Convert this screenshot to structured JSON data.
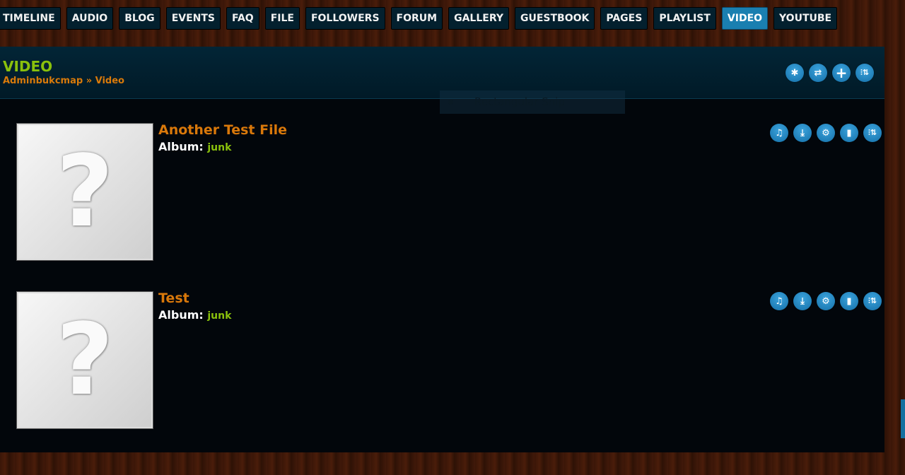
{
  "nav": {
    "tabs": [
      "TIMELINE",
      "AUDIO",
      "BLOG",
      "EVENTS",
      "FAQ",
      "FILE",
      "FOLLOWERS",
      "FORUM",
      "GALLERY",
      "GUESTBOOK",
      "PAGES",
      "PLAYLIST",
      "VIDEO",
      "YOUTUBE"
    ],
    "active": "VIDEO"
  },
  "header": {
    "title": "VIDEO",
    "breadcrumb": {
      "user": "Adminbukcmap",
      "sep": "»",
      "page": "Video"
    }
  },
  "header_icons": [
    "asterisk-icon",
    "refresh-icon",
    "plus-icon",
    "sort-icon"
  ],
  "items": [
    {
      "title": "Another Test File",
      "album_label": "Album:",
      "album": "junk",
      "thumb": "?"
    },
    {
      "title": "Test",
      "album_label": "Album:",
      "album": "junk",
      "thumb": "?"
    }
  ],
  "item_icons": [
    "music-icon",
    "download-icon",
    "gear-icon",
    "trash-icon",
    "sort-icon"
  ],
  "overlay": {
    "text": "Rectangular Snip"
  },
  "colors": {
    "accent": "#1a7fb0",
    "title": "#8ac10c",
    "link": "#d9780a"
  }
}
